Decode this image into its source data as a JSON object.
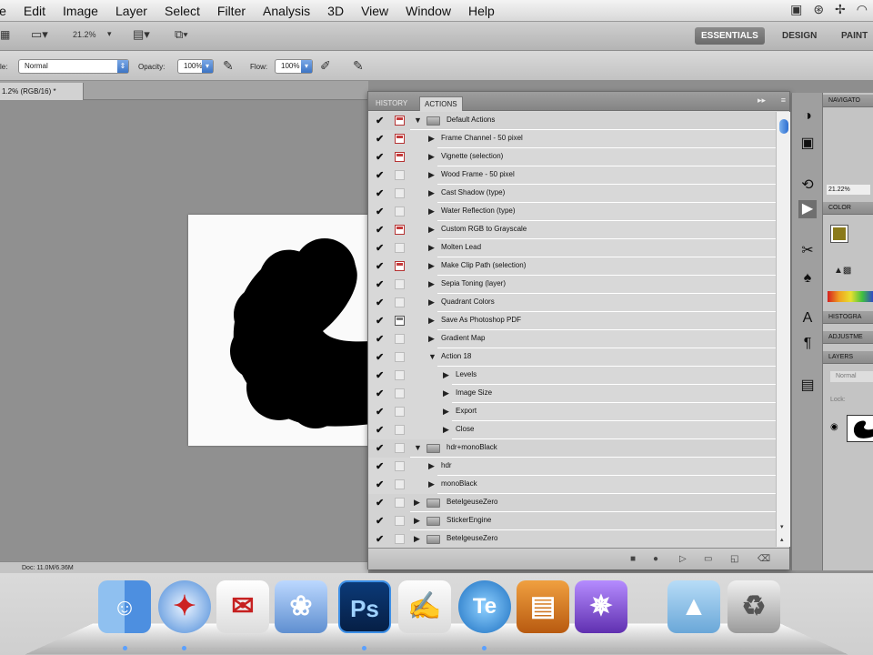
{
  "menubar": {
    "items": [
      "le",
      "Edit",
      "Image",
      "Layer",
      "Select",
      "Filter",
      "Analysis",
      "3D",
      "View",
      "Window",
      "Help"
    ]
  },
  "appbar": {
    "zoom": "21.2%",
    "zoom_arrow": "▾",
    "workspaces": [
      "ESSENTIALS",
      "DESIGN",
      "PAINT"
    ]
  },
  "options": {
    "mode_label": "le:",
    "mode_value": "Normal",
    "opacity_label": "Opacity:",
    "opacity_value": "100%",
    "flow_label": "Flow:",
    "flow_value": "100%"
  },
  "document": {
    "tab_title": "1.2% (RGB/16) *",
    "status": "Doc: 11.0M/6.36M"
  },
  "panel": {
    "tabs": [
      "HISTORY",
      "ACTIONS"
    ],
    "rows": [
      {
        "label": "Default Actions",
        "kind": "set",
        "expanded": true,
        "dialog": "on"
      },
      {
        "label": "Frame Channel - 50 pixel",
        "kind": "action",
        "dialog": "on"
      },
      {
        "label": "Vignette (selection)",
        "kind": "action",
        "dialog": "on"
      },
      {
        "label": "Wood Frame - 50 pixel",
        "kind": "action",
        "dialog": "off"
      },
      {
        "label": "Cast Shadow (type)",
        "kind": "action",
        "dialog": "off"
      },
      {
        "label": "Water Reflection (type)",
        "kind": "action",
        "dialog": "off"
      },
      {
        "label": "Custom RGB to Grayscale",
        "kind": "action",
        "dialog": "on"
      },
      {
        "label": "Molten Lead",
        "kind": "action",
        "dialog": "off"
      },
      {
        "label": "Make Clip Path (selection)",
        "kind": "action",
        "dialog": "on"
      },
      {
        "label": "Sepia Toning (layer)",
        "kind": "action",
        "dialog": "off"
      },
      {
        "label": "Quadrant Colors",
        "kind": "action",
        "dialog": "off"
      },
      {
        "label": "Save As Photoshop PDF",
        "kind": "action",
        "dialog": "gray"
      },
      {
        "label": "Gradient Map",
        "kind": "action",
        "dialog": "off"
      },
      {
        "label": "Action 18",
        "kind": "action",
        "expanded": true,
        "dialog": "off"
      },
      {
        "label": "Levels",
        "kind": "step",
        "dialog": "off"
      },
      {
        "label": "Image Size",
        "kind": "step",
        "dialog": "off"
      },
      {
        "label": "Export",
        "kind": "step",
        "dialog": "off"
      },
      {
        "label": "Close",
        "kind": "step",
        "dialog": "off"
      },
      {
        "label": "hdr+monoBlack",
        "kind": "set",
        "expanded": true,
        "dialog": "off"
      },
      {
        "label": "hdr",
        "kind": "action",
        "dialog": "off"
      },
      {
        "label": "monoBlack",
        "kind": "action",
        "dialog": "off"
      },
      {
        "label": "BetelgeuseZero",
        "kind": "set",
        "expanded": false,
        "dialog": "off"
      },
      {
        "label": "StickerEngine",
        "kind": "set",
        "expanded": false,
        "dialog": "off"
      },
      {
        "label": "BetelgeuseZero",
        "kind": "set",
        "expanded": false,
        "dialog": "off"
      }
    ],
    "footer_icons": [
      "stop-icon",
      "record-icon",
      "play-icon",
      "new-set-icon",
      "new-action-icon",
      "delete-icon"
    ]
  },
  "right": {
    "navigator_tab": "NAVIGATO",
    "navigator_zoom": "21.22%",
    "color_tab": "COLOR",
    "histogram_tab": "HISTOGRA",
    "adjustments_tab": "ADJUSTME",
    "layers_tab": "LAYERS",
    "layers_mode": "Normal",
    "lock_label": "Lock:"
  },
  "dock": {
    "apps": [
      "Finder",
      "Safari",
      "Mail",
      "iPhoto",
      "Ps",
      "TextEdit",
      "Te",
      "Keynote",
      "iMovie",
      "Applications",
      "Trash"
    ]
  },
  "colors": {
    "accent": "#3d74c4",
    "record_red": "#c43a3a",
    "foreground_swatch": "#8a7a1a"
  }
}
